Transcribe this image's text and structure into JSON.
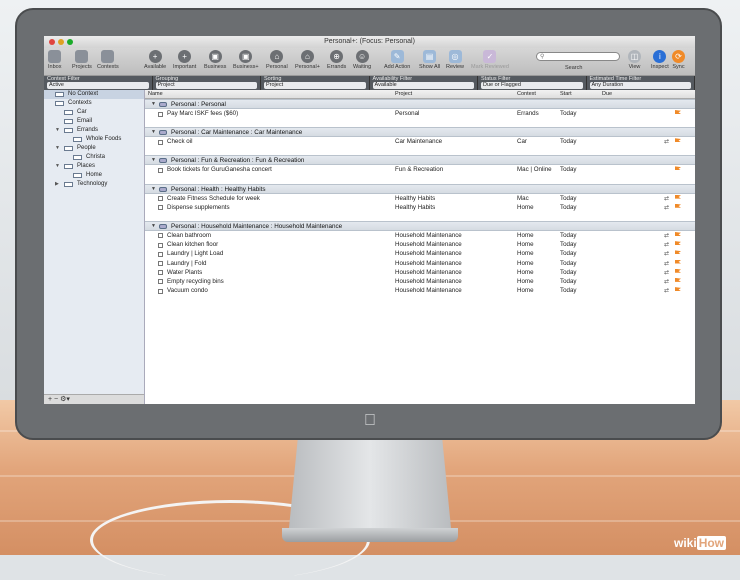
{
  "window": {
    "title": "Personal+: (Focus: Personal)"
  },
  "toolbar": {
    "left": [
      {
        "name": "inbox-button",
        "icon": "inbox-icon",
        "label": "Inbox"
      },
      {
        "name": "projects-button",
        "icon": "projects-icon",
        "label": "Projects"
      },
      {
        "name": "contexts-button",
        "icon": "contexts-icon",
        "label": "Contexts"
      }
    ],
    "perspectives": [
      {
        "name": "available-button",
        "label": "Available"
      },
      {
        "name": "important-button",
        "label": "Important"
      },
      {
        "name": "business-button",
        "label": "Business"
      },
      {
        "name": "business-plus-button",
        "label": "Business+"
      },
      {
        "name": "personal-button",
        "label": "Personal"
      },
      {
        "name": "personal-plus-button",
        "label": "Personal+"
      },
      {
        "name": "errands-button",
        "label": "Errands"
      },
      {
        "name": "waiting-button",
        "label": "Waiting"
      },
      {
        "name": "add-action-button",
        "label": "Add Action"
      },
      {
        "name": "show-all-button",
        "label": "Show All"
      },
      {
        "name": "review-button",
        "label": "Review"
      },
      {
        "name": "mark-reviewed-button",
        "label": "Mark Reviewed"
      }
    ],
    "search_label": "Search",
    "right": [
      {
        "name": "view-button",
        "label": "View"
      },
      {
        "name": "inspect-button",
        "label": "Inspect"
      },
      {
        "name": "sync-button",
        "label": "Sync"
      }
    ]
  },
  "filters": [
    {
      "label": "Context Filter",
      "value": "Active"
    },
    {
      "label": "Grouping",
      "value": "Project"
    },
    {
      "label": "Sorting",
      "value": "Project"
    },
    {
      "label": "Availability Filter",
      "value": "Available"
    },
    {
      "label": "Status Filter",
      "value": "Due or Flagged"
    },
    {
      "label": "Estimated Time Filter",
      "value": "Any Duration"
    }
  ],
  "sidebar": {
    "items": [
      {
        "label": "No Context",
        "level": 0
      },
      {
        "label": "Contexts",
        "level": 0
      },
      {
        "label": "Car",
        "level": 1
      },
      {
        "label": "Email",
        "level": 1
      },
      {
        "label": "Errands",
        "level": 1
      },
      {
        "label": "Whole Foods",
        "level": 2
      },
      {
        "label": "People",
        "level": 1
      },
      {
        "label": "Christa",
        "level": 2
      },
      {
        "label": "Places",
        "level": 1
      },
      {
        "label": "Home",
        "level": 2
      },
      {
        "label": "Technology",
        "level": 1
      }
    ],
    "bottom": "+  −  ⚙▾"
  },
  "columns": {
    "name": "Name",
    "project": "Project",
    "context": "Context",
    "start": "Start",
    "due": "Due"
  },
  "groups": [
    {
      "title": "Personal : Personal",
      "tasks": [
        {
          "name": "Pay Marc ISKF fees ($60)",
          "project": "Personal",
          "context": "Errands",
          "start": "Today",
          "repeat": false
        }
      ]
    },
    {
      "title": "Personal : Car Maintenance : Car Maintenance",
      "tasks": [
        {
          "name": "Check oil",
          "project": "Car Maintenance",
          "context": "Car",
          "start": "Today",
          "repeat": true
        }
      ]
    },
    {
      "title": "Personal : Fun & Recreation : Fun & Recreation",
      "tasks": [
        {
          "name": "Book tickets for GuruGanesha concert",
          "project": "Fun & Recreation",
          "context": "Mac | Online",
          "start": "Today",
          "repeat": false
        }
      ]
    },
    {
      "title": "Personal : Health : Healthy Habits",
      "tasks": [
        {
          "name": "Create Fitness Schedule for week",
          "project": "Healthy Habits",
          "context": "Mac",
          "start": "Today",
          "repeat": true
        },
        {
          "name": "Dispense supplements",
          "project": "Healthy Habits",
          "context": "Home",
          "start": "Today",
          "repeat": true
        }
      ]
    },
    {
      "title": "Personal : Household Maintenance : Household Maintenance",
      "tasks": [
        {
          "name": "Clean bathroom",
          "project": "Household Maintenance",
          "context": "Home",
          "start": "Today",
          "repeat": true
        },
        {
          "name": "Clean kitchen floor",
          "project": "Household Maintenance",
          "context": "Home",
          "start": "Today",
          "repeat": true
        },
        {
          "name": "Laundry | Light Load",
          "project": "Household Maintenance",
          "context": "Home",
          "start": "Today",
          "repeat": true
        },
        {
          "name": "Laundry | Fold",
          "project": "Household Maintenance",
          "context": "Home",
          "start": "Today",
          "repeat": true
        },
        {
          "name": "Water Plants",
          "project": "Household Maintenance",
          "context": "Home",
          "start": "Today",
          "repeat": true
        },
        {
          "name": "Empty recycling bins",
          "project": "Household Maintenance",
          "context": "Home",
          "start": "Today",
          "repeat": true
        },
        {
          "name": "Vacuum condo",
          "project": "Household Maintenance",
          "context": "Home",
          "start": "Today",
          "repeat": true
        }
      ]
    }
  ],
  "watermark": {
    "wiki": "wiki",
    "how": "How"
  },
  "colors": {
    "flag": "#f08a28",
    "filterbar": "#555a60",
    "sidebar": "#e6ebf2"
  }
}
